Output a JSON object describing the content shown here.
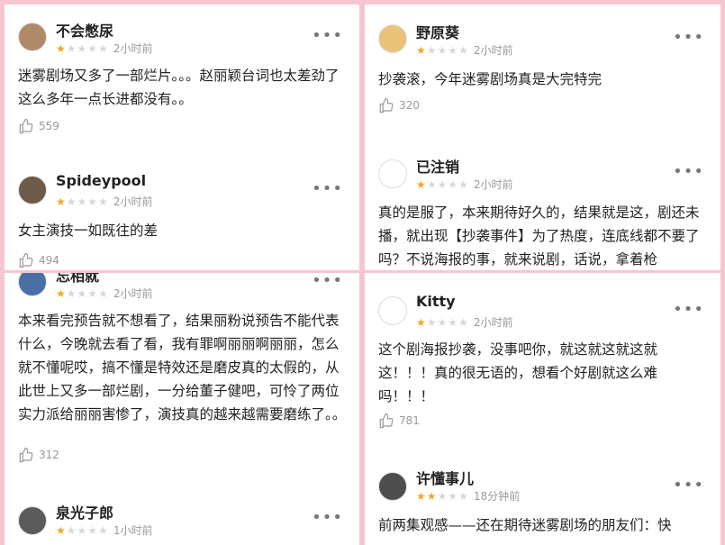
{
  "colors": {
    "star_on": "#f5a623",
    "star_off": "#d8d8d8",
    "background": "#f6c6d0"
  },
  "more_label": "•••",
  "panels": [
    {
      "comments": [
        {
          "user": "不会憋尿",
          "time": "2小时前",
          "rating": 1,
          "text": "迷雾剧场又多了一部烂片。。。赵丽颖台词也太差劲了 这么多年一点长进都没有。。",
          "likes": "559"
        },
        {
          "user": "Spideypool",
          "time": "2小时前",
          "rating": 1,
          "text": "女主演技一如既往的差",
          "likes": "494"
        }
      ]
    },
    {
      "comments": [
        {
          "user": "野原葵",
          "time": "2小时前",
          "rating": 1,
          "text": "抄袭滚，今年迷雾剧场真是大完特完",
          "likes": "320"
        },
        {
          "user": "已注销",
          "time": "2小时前",
          "rating": 1,
          "text": "真的是服了，本来期待好久的，结果就是这，剧还未播，就出现【抄袭事件】为了热度，连底线都不要了吗？不说海报的事，就来说剧，话说，拿着枪",
          "likes": ""
        }
      ]
    },
    {
      "comments": [
        {
          "user": "忘相就",
          "time": "2小时前",
          "rating": 1,
          "text": "本来看完预告就不想看了，结果丽粉说预告不能代表什么，今晚就去看了看，我有罪啊丽丽啊丽丽，怎么就不懂呢哎，搞不懂是特效还是磨皮真的太假的，从此世上又多一部烂剧，一分给董子健吧，可怜了两位实力派给丽丽害惨了，演技真的越来越需要磨练了。。",
          "likes": "312"
        },
        {
          "user": "泉光子郎",
          "time": "1小时前",
          "rating": 1,
          "text": "",
          "likes": ""
        }
      ]
    },
    {
      "comments": [
        {
          "user": "Kitty",
          "time": "2小时前",
          "rating": 1,
          "text": "这个剧海报抄袭，没事吧你，就这就这就这就这！！！真的很无语的，想看个好剧就这么难吗！！！",
          "likes": "781"
        },
        {
          "user": "许懂事儿",
          "time": "18分钟前",
          "rating": 2,
          "text": "前两集观感——还在期待迷雾剧场的朋友们：快",
          "likes": ""
        }
      ]
    }
  ]
}
